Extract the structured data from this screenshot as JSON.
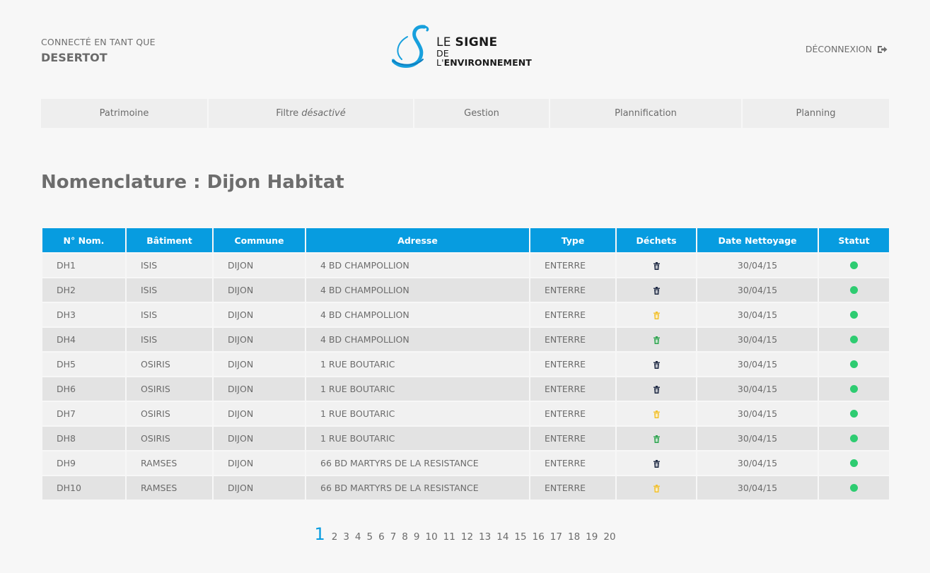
{
  "header": {
    "user_caption": "CONNECTÉ EN TANT QUE",
    "user_name": "DESERTOT",
    "logo_line1_a": "LE ",
    "logo_line1_b": "SIGNE",
    "logo_line2_a": "DE L'",
    "logo_line2_b": "ENVIRONNEMENT",
    "logout_label": "DÉCONNEXION"
  },
  "nav": {
    "patrimoine": "Patrimoine",
    "filtre": "Filtre",
    "filtre_state": "désactivé",
    "gestion": "Gestion",
    "plannification": "Plannification",
    "planning": "Planning"
  },
  "page_title": "Nomenclature : Dijon Habitat",
  "table": {
    "headers": [
      "N° Nom.",
      "Bâtiment",
      "Commune",
      "Adresse",
      "Type",
      "Déchets",
      "Date Nettoyage",
      "Statut"
    ],
    "rows": [
      {
        "num": "DH1",
        "batiment": "ISIS",
        "commune": "DIJON",
        "adresse": "4 BD CHAMPOLLION",
        "type": "ENTERRE",
        "dechets": "trash-dark",
        "date": "30/04/15",
        "statut": "green-status"
      },
      {
        "num": "DH2",
        "batiment": "ISIS",
        "commune": "DIJON",
        "adresse": "4 BD CHAMPOLLION",
        "type": "ENTERRE",
        "dechets": "trash-dark",
        "date": "30/04/15",
        "statut": "green-status"
      },
      {
        "num": "DH3",
        "batiment": "ISIS",
        "commune": "DIJON",
        "adresse": "4 BD CHAMPOLLION",
        "type": "ENTERRE",
        "dechets": "trash-yellow",
        "date": "30/04/15",
        "statut": "green-status"
      },
      {
        "num": "DH4",
        "batiment": "ISIS",
        "commune": "DIJON",
        "adresse": "4 BD CHAMPOLLION",
        "type": "ENTERRE",
        "dechets": "trash-green",
        "date": "30/04/15",
        "statut": "green-status"
      },
      {
        "num": "DH5",
        "batiment": "OSIRIS",
        "commune": "DIJON",
        "adresse": "1 RUE BOUTARIC",
        "type": "ENTERRE",
        "dechets": "trash-dark",
        "date": "30/04/15",
        "statut": "green-status"
      },
      {
        "num": "DH6",
        "batiment": "OSIRIS",
        "commune": "DIJON",
        "adresse": "1 RUE BOUTARIC",
        "type": "ENTERRE",
        "dechets": "trash-dark",
        "date": "30/04/15",
        "statut": "green-status"
      },
      {
        "num": "DH7",
        "batiment": "OSIRIS",
        "commune": "DIJON",
        "adresse": "1 RUE BOUTARIC",
        "type": "ENTERRE",
        "dechets": "trash-yellow",
        "date": "30/04/15",
        "statut": "green-status"
      },
      {
        "num": "DH8",
        "batiment": "OSIRIS",
        "commune": "DIJON",
        "adresse": "1 RUE BOUTARIC",
        "type": "ENTERRE",
        "dechets": "trash-green",
        "date": "30/04/15",
        "statut": "green-status"
      },
      {
        "num": "DH9",
        "batiment": "RAMSES",
        "commune": "DIJON",
        "adresse": "66 BD MARTYRS DE LA RESISTANCE",
        "type": "ENTERRE",
        "dechets": "trash-dark",
        "date": "30/04/15",
        "statut": "green-status"
      },
      {
        "num": "DH10",
        "batiment": "RAMSES",
        "commune": "DIJON",
        "adresse": "66 BD MARTYRS DE LA RESISTANCE",
        "type": "ENTERRE",
        "dechets": "trash-yellow",
        "date": "30/04/15",
        "statut": "green-status"
      }
    ]
  },
  "pagination": {
    "current": "1",
    "pages": [
      "2",
      "3",
      "4",
      "5",
      "6",
      "7",
      "8",
      "9",
      "10",
      "11",
      "12",
      "13",
      "14",
      "15",
      "16",
      "17",
      "18",
      "19",
      "20"
    ]
  },
  "colors": {
    "accent": "#079ce0",
    "trash-dark": "#1f2a44",
    "trash-yellow": "#f2c12e",
    "trash-green": "#2ea44f",
    "green-status": "#2ecc71"
  }
}
